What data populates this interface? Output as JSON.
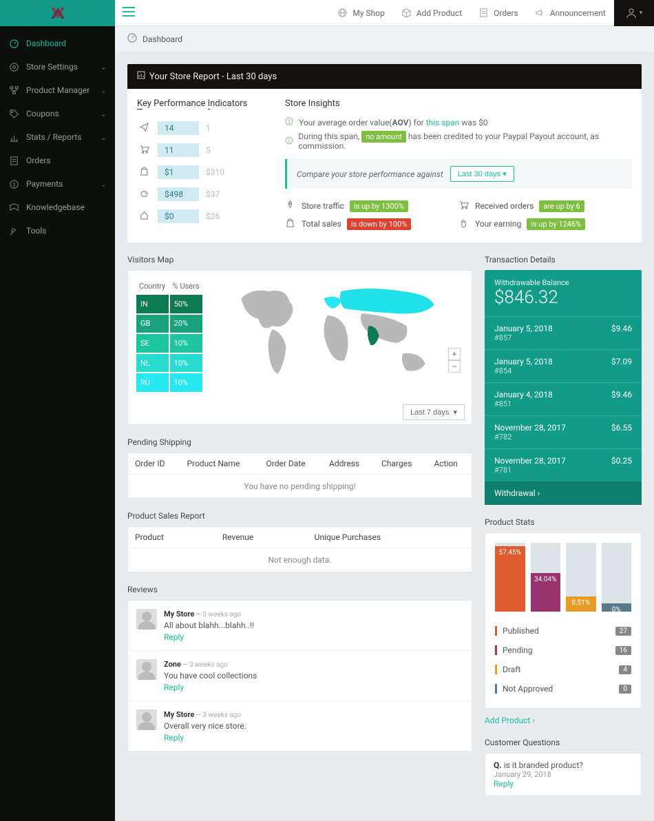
{
  "colors": {
    "teal": "#129b89",
    "green": "#7fbf3f",
    "red": "#e04030",
    "orange": "#dd5b2e",
    "purple": "#99336e",
    "amber": "#e89c28",
    "slate": "#5a7a8a"
  },
  "topbar": {
    "links": [
      {
        "icon": "globe-icon",
        "label": "My Shop"
      },
      {
        "icon": "box-icon",
        "label": "Add Product"
      },
      {
        "icon": "clipboard-icon",
        "label": "Orders"
      },
      {
        "icon": "megaphone-icon",
        "label": "Announcement"
      }
    ]
  },
  "breadcrumb": {
    "title": "Dashboard"
  },
  "sidebar": {
    "items": [
      {
        "icon": "dashboard-icon",
        "label": "Dashboard",
        "active": true,
        "expandable": false
      },
      {
        "icon": "gear-icon",
        "label": "Store Settings",
        "active": false,
        "expandable": true
      },
      {
        "icon": "tree-icon",
        "label": "Product Manager",
        "active": false,
        "expandable": true
      },
      {
        "icon": "tag-icon",
        "label": "Coupons",
        "active": false,
        "expandable": true
      },
      {
        "icon": "chart-icon",
        "label": "Stats / Reports",
        "active": false,
        "expandable": true
      },
      {
        "icon": "clipboard-icon",
        "label": "Orders",
        "active": false,
        "expandable": false
      },
      {
        "icon": "money-icon",
        "label": "Payments",
        "active": false,
        "expandable": true
      },
      {
        "icon": "book-icon",
        "label": "Knowledgebase",
        "active": false,
        "expandable": false
      },
      {
        "icon": "wrench-icon",
        "label": "Tools",
        "active": false,
        "expandable": false
      }
    ]
  },
  "store_report": {
    "title": "Your Store Report - Last 30 days",
    "kpi_title": "Key Performance Indicators",
    "insights_title": "Store Insights",
    "kpi": [
      {
        "icon": "paper-plane-icon",
        "val": "14",
        "prev": "1"
      },
      {
        "icon": "cart-icon",
        "val": "11",
        "prev": "5"
      },
      {
        "icon": "bag-icon",
        "val": "$1",
        "prev": "$310"
      },
      {
        "icon": "piggy-icon",
        "val": "$498",
        "prev": "$37"
      },
      {
        "icon": "house-icon",
        "val": "$0",
        "prev": "$26"
      }
    ],
    "insight1_pre": "Your average order value(",
    "insight1_bold": "AOV",
    "insight1_post": ") for ",
    "insight1_link": "this span",
    "insight1_end": " was $0",
    "insight2_pre": "During this span, ",
    "insight2_badge": "no amount",
    "insight2_post": " has been credited to your Paypal Payout account, as commission.",
    "compare_text": "Compare your store performance against",
    "compare_dd": "Last 30 days",
    "perf": [
      {
        "icon": "rocket-icon",
        "label": "Store traffic",
        "badge": "is up by 1300%",
        "good": true
      },
      {
        "icon": "cart-icon",
        "label": "Received orders",
        "badge": "are up by 6",
        "good": true
      },
      {
        "icon": "bag-icon",
        "label": "Total sales",
        "badge": "is down by 100%",
        "good": false
      },
      {
        "icon": "hand-icon",
        "label": "Your earning",
        "badge": "is up by 1246%",
        "good": true
      }
    ]
  },
  "visitors_map": {
    "title": "Visitors Map",
    "th_country": "Country",
    "th_users": "% Users",
    "dd": "Last 7 days",
    "rows": [
      {
        "code": "IN",
        "pct": "50%",
        "color": "#0d7a54"
      },
      {
        "code": "GB",
        "pct": "20%",
        "color": "#19a17a"
      },
      {
        "code": "SE",
        "pct": "10%",
        "color": "#1cc4a0"
      },
      {
        "code": "NL",
        "pct": "10%",
        "color": "#27dccf"
      },
      {
        "code": "RU",
        "pct": "10%",
        "color": "#25e8f0"
      }
    ]
  },
  "pending_shipping": {
    "title": "Pending Shipping",
    "cols": [
      "Order ID",
      "Product Name",
      "Order Date",
      "Address",
      "Charges",
      "Action"
    ],
    "empty": "You have no pending shipping!"
  },
  "sales_report": {
    "title": "Product Sales Report",
    "cols": [
      "Product",
      "Revenue",
      "Unique Purchases"
    ],
    "empty": "Not enough data."
  },
  "reviews": {
    "title": "Reviews",
    "reply": "Reply",
    "items": [
      {
        "author": "My Store",
        "time": "3 weeks ago",
        "text": "All about blahh...blahh..!!"
      },
      {
        "author": "Zone",
        "time": "3 weeks ago",
        "text": "You have cool collections"
      },
      {
        "author": "My Store",
        "time": "3 weeks ago",
        "text": "Overall very nice store."
      }
    ]
  },
  "transactions": {
    "title": "Transaction Details",
    "wb_label": "Withdrawable Balance",
    "wb_amount": "$846.32",
    "items": [
      {
        "date": "January 5, 2018",
        "id": "#857",
        "amt": "$9.46"
      },
      {
        "date": "January 5, 2018",
        "id": "#854",
        "amt": "$7.09"
      },
      {
        "date": "January 4, 2018",
        "id": "#851",
        "amt": "$9.46"
      },
      {
        "date": "November 28, 2017",
        "id": "#782",
        "amt": "$6.55"
      },
      {
        "date": "November 28, 2017",
        "id": "#781",
        "amt": "$0.25"
      }
    ],
    "withdraw": "Withdrawal"
  },
  "product_stats": {
    "title": "Product Stats",
    "add_product": "Add Product",
    "bars": [
      {
        "pct": "57.45%",
        "h": 95,
        "color": "#dd5b2e"
      },
      {
        "pct": "34.04%",
        "h": 56,
        "color": "#99336e"
      },
      {
        "pct": "8.51%",
        "h": 22,
        "color": "#e89c28"
      },
      {
        "pct": "0%",
        "h": 12,
        "color": "#5a7a8a"
      }
    ],
    "rows": [
      {
        "label": "Published",
        "count": "27",
        "color": "#dd5b2e"
      },
      {
        "label": "Pending",
        "count": "16",
        "color": "#99336e"
      },
      {
        "label": "Draft",
        "count": "4",
        "color": "#e89c28"
      },
      {
        "label": "Not Approved",
        "count": "0",
        "color": "#5a7a8a"
      }
    ]
  },
  "customer_q": {
    "title": "Customer Questions",
    "q_label": "Q.",
    "q_text": "is it branded product?",
    "q_date": "January 29, 2018",
    "reply": "Reply"
  },
  "chart_data": [
    {
      "type": "table",
      "title": "Visitors by country (last 7 days)",
      "categories": [
        "IN",
        "GB",
        "SE",
        "NL",
        "RU"
      ],
      "values": [
        50,
        20,
        10,
        10,
        10
      ],
      "ylabel": "% Users"
    },
    {
      "type": "bar",
      "title": "Product Stats",
      "categories": [
        "Published",
        "Pending",
        "Draft",
        "Not Approved"
      ],
      "values": [
        57.45,
        34.04,
        8.51,
        0
      ],
      "ylabel": "%",
      "ylim": [
        0,
        100
      ]
    }
  ]
}
